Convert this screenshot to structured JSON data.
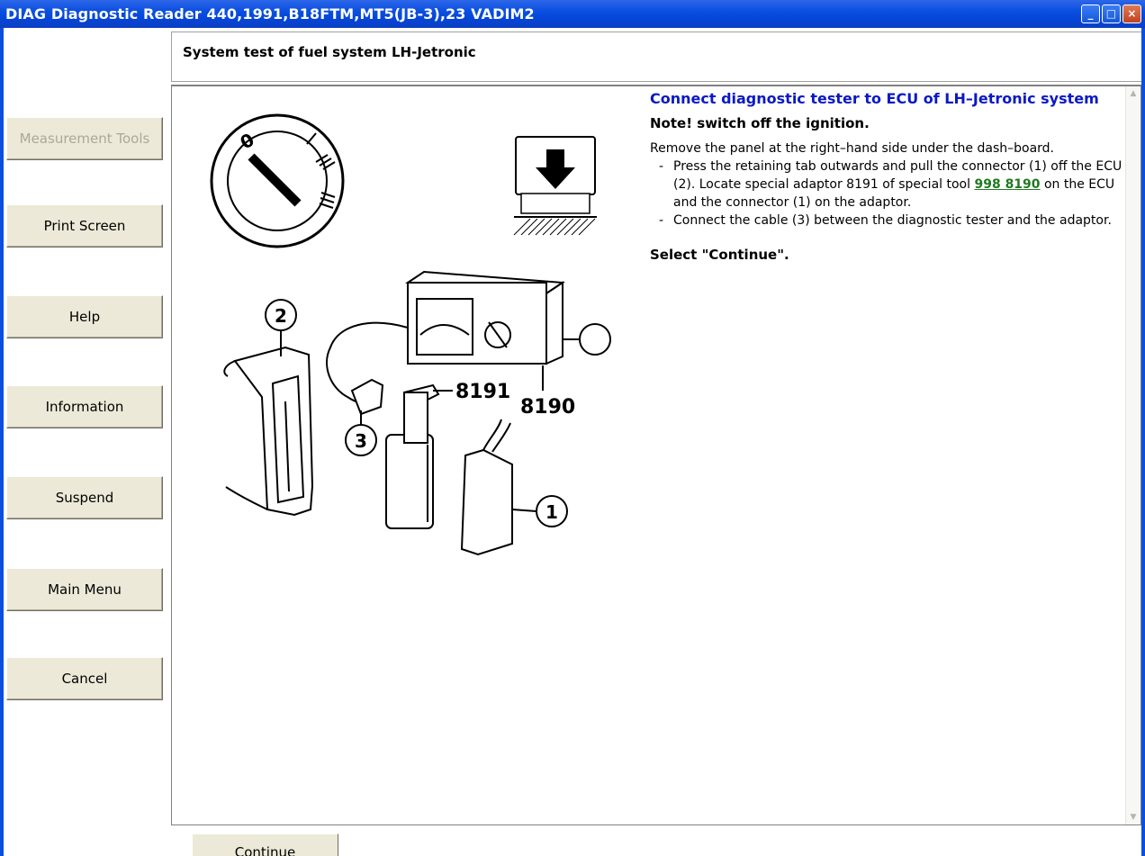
{
  "window": {
    "title": "DIAG Diagnostic Reader 440,1991,B18FTM,MT5(JB-3),23 VADIM2"
  },
  "sidebar": {
    "measurement_tools": "Measurement Tools",
    "print_screen": "Print Screen",
    "help": "Help",
    "information": "Information",
    "suspend": "Suspend",
    "main_menu": "Main Menu",
    "cancel": "Cancel"
  },
  "header": {
    "title": "System test of fuel system LH-Jetronic"
  },
  "instructions": {
    "heading": "Connect diagnostic tester to ECU of LH–Jetronic system",
    "note": "Note! switch off the ignition.",
    "intro": "Remove the panel at the right–hand side under the dash–board.",
    "step1_dash": "-",
    "step1_before": "Press the retaining tab outwards and pull the connector (1) off the ECU (2). Locate special adaptor 8191 of special tool ",
    "step1_link": "998 8190",
    "step1_after": " on the ECU and the connector (1) on the adaptor.",
    "step2_dash": "-",
    "step2": "Connect the cable (3) between the diagnostic tester and the adaptor.",
    "select": "Select \"Continue\"."
  },
  "figure": {
    "key_label": "0",
    "callout_1": "1",
    "callout_2": "2",
    "callout_3": "3",
    "label_8191": "8191",
    "label_8190": "8190"
  },
  "footer": {
    "continue": "Continue"
  }
}
